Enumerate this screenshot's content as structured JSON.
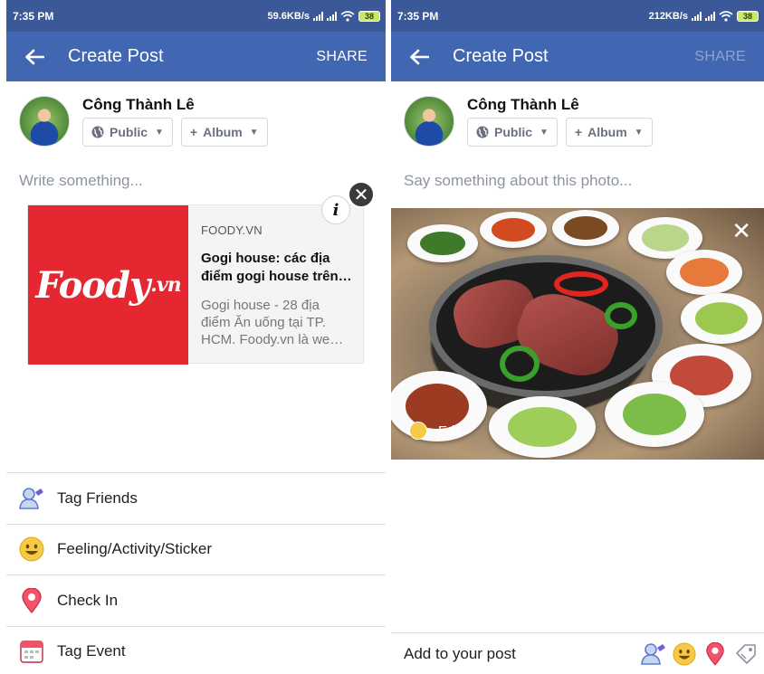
{
  "left_screen": {
    "status": {
      "time": "7:35 PM",
      "speed": "59.6KB/s",
      "battery": "38"
    },
    "appbar": {
      "title": "Create Post",
      "share_label": "SHARE"
    },
    "user": {
      "name": "Công Thành Lê"
    },
    "privacy_chip": {
      "label": "Public",
      "icon": "globe-icon"
    },
    "album_chip": {
      "label": "Album",
      "icon": "plus-icon"
    },
    "composer": {
      "placeholder": "Write something..."
    },
    "link_preview": {
      "thumb_text": "Foody",
      "thumb_suffix": ".vn",
      "domain": "FOODY.VN",
      "title": "Gogi house: các địa điểm gogi house trên…",
      "description": "Gogi house - 28 địa điểm Ăn uống tại TP. HCM. Foody.vn là we…",
      "thumb_color": "#e42731"
    },
    "options": [
      {
        "label": "Tag Friends",
        "icon": "tag-friends-icon"
      },
      {
        "label": "Feeling/Activity/Sticker",
        "icon": "smiley-icon"
      },
      {
        "label": "Check In",
        "icon": "location-pin-icon"
      },
      {
        "label": "Tag Event",
        "icon": "calendar-icon"
      }
    ]
  },
  "right_screen": {
    "status": {
      "time": "7:35 PM",
      "speed": "212KB/s",
      "battery": "38"
    },
    "appbar": {
      "title": "Create Post",
      "share_label": "SHARE"
    },
    "user": {
      "name": "Công Thành Lê"
    },
    "privacy_chip": {
      "label": "Public",
      "icon": "globe-icon"
    },
    "album_chip": {
      "label": "Album",
      "icon": "plus-icon"
    },
    "composer": {
      "placeholder": "Say something about this photo..."
    },
    "photo": {
      "edit_label": "Edit"
    },
    "add_bar": {
      "label": "Add to your post",
      "icons": [
        "tag-friends-icon",
        "smiley-icon",
        "location-pin-icon",
        "tag-icon"
      ]
    }
  },
  "colors": {
    "header": "#4267b2",
    "statusbar": "#3b5998",
    "share_disabled": "#8ea3cf"
  }
}
